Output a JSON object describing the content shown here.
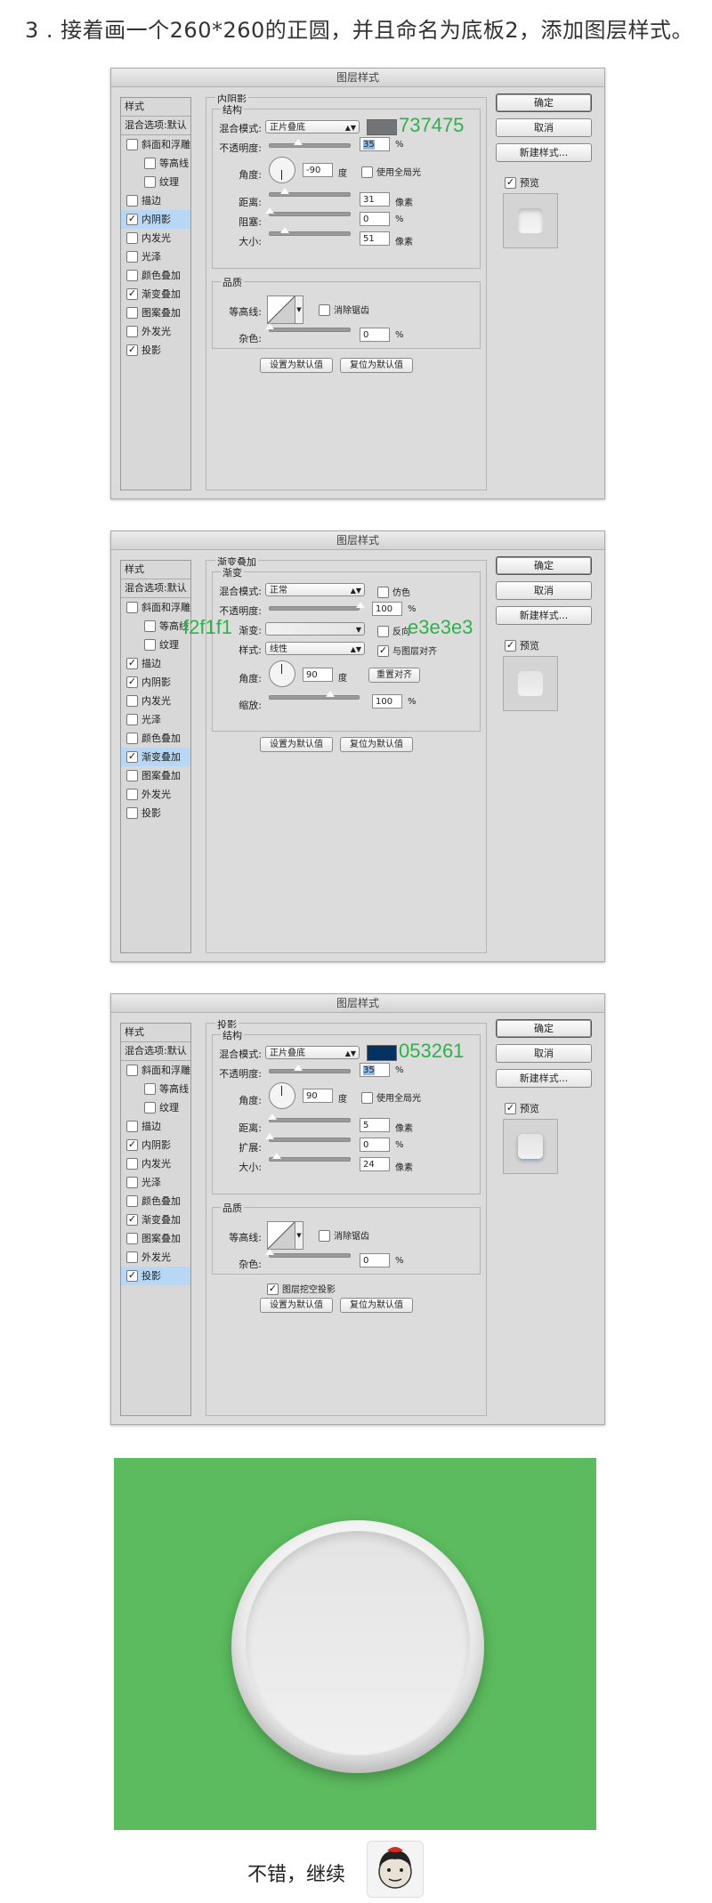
{
  "heading": "3 . 接着画一个260*260的正圆，并且命名为底板2，添加图层样式。",
  "dialogs": [
    {
      "title": "图层样式",
      "styles_header": "样式",
      "blend_default": "混合选项:默认",
      "items": [
        {
          "label": "斜面和浮雕",
          "checked": false,
          "sub": false,
          "active": false
        },
        {
          "label": "等高线",
          "checked": false,
          "sub": true,
          "active": false
        },
        {
          "label": "纹理",
          "checked": false,
          "sub": true,
          "active": false
        },
        {
          "label": "描边",
          "checked": false,
          "sub": false,
          "active": false
        },
        {
          "label": "内阴影",
          "checked": true,
          "sub": false,
          "active": true
        },
        {
          "label": "内发光",
          "checked": false,
          "sub": false,
          "active": false
        },
        {
          "label": "光泽",
          "checked": false,
          "sub": false,
          "active": false
        },
        {
          "label": "颜色叠加",
          "checked": false,
          "sub": false,
          "active": false
        },
        {
          "label": "渐变叠加",
          "checked": true,
          "sub": false,
          "active": false
        },
        {
          "label": "图案叠加",
          "checked": false,
          "sub": false,
          "active": false
        },
        {
          "label": "外发光",
          "checked": false,
          "sub": false,
          "active": false
        },
        {
          "label": "投影",
          "checked": true,
          "sub": false,
          "active": false
        }
      ],
      "section_title": "内阴影",
      "structure_label": "结构",
      "blend_mode_label": "混合模式:",
      "blend_mode": "正片叠底",
      "swatch_color": "#737475",
      "swatch_note": "737475",
      "opacity_label": "不透明度:",
      "opacity": "35",
      "opacity_level": 0.35,
      "angle_label": "角度:",
      "angle": "-90",
      "angle_unit": "度",
      "global_light": "使用全局光",
      "distance_label": "距离:",
      "distance": "31",
      "distance_level": 0.18,
      "choke_label": "阻塞:",
      "choke": "0",
      "choke_level": 0.0,
      "size_label": "大小:",
      "size": "51",
      "size_level": 0.19,
      "px": "像素",
      "percent": "%",
      "quality_label": "品质",
      "contour_label": "等高线:",
      "antialias": "消除锯齿",
      "noise_label": "杂色:",
      "noise": "0",
      "btn_default": "设置为默认值",
      "btn_reset": "复位为默认值",
      "ok": "确定",
      "cancel": "取消",
      "new_style": "新建样式...",
      "preview": "预览"
    },
    {
      "title": "图层样式",
      "styles_header": "样式",
      "blend_default": "混合选项:默认",
      "items": [
        {
          "label": "斜面和浮雕",
          "checked": false,
          "sub": false,
          "active": false
        },
        {
          "label": "等高线",
          "checked": false,
          "sub": true,
          "active": false
        },
        {
          "label": "纹理",
          "checked": false,
          "sub": true,
          "active": false
        },
        {
          "label": "描边",
          "checked": true,
          "sub": false,
          "active": false
        },
        {
          "label": "内阴影",
          "checked": true,
          "sub": false,
          "active": false
        },
        {
          "label": "内发光",
          "checked": false,
          "sub": false,
          "active": false
        },
        {
          "label": "光泽",
          "checked": false,
          "sub": false,
          "active": false
        },
        {
          "label": "颜色叠加",
          "checked": false,
          "sub": false,
          "active": false
        },
        {
          "label": "渐变叠加",
          "checked": true,
          "sub": false,
          "active": true
        },
        {
          "label": "图案叠加",
          "checked": false,
          "sub": false,
          "active": false
        },
        {
          "label": "外发光",
          "checked": false,
          "sub": false,
          "active": false
        },
        {
          "label": "投影",
          "checked": false,
          "sub": false,
          "active": false
        }
      ],
      "section_title": "渐变叠加",
      "structure_label": "渐变",
      "blend_mode_label": "混合模式:",
      "blend_mode": "正常",
      "dither": "仿色",
      "opacity_label": "不透明度:",
      "opacity": "100",
      "opacity_level": 1.0,
      "gradient_label": "渐变:",
      "gradient_from": "#f2f1f1",
      "gradient_to": "#e3e3e3",
      "note_left": "f2f1f1",
      "note_right": "e3e3e3",
      "reverse": "反向",
      "style_label": "样式:",
      "style_value": "线性",
      "align_layer": "与图层对齐",
      "angle_label": "角度:",
      "angle": "90",
      "angle_unit": "度",
      "reset_align": "重置对齐",
      "scale_label": "缩放:",
      "scale": "100",
      "scale_level": 0.67,
      "percent": "%",
      "btn_default": "设置为默认值",
      "btn_reset": "复位为默认值",
      "ok": "确定",
      "cancel": "取消",
      "new_style": "新建样式...",
      "preview": "预览"
    },
    {
      "title": "图层样式",
      "styles_header": "样式",
      "blend_default": "混合选项:默认",
      "items": [
        {
          "label": "斜面和浮雕",
          "checked": false,
          "sub": false,
          "active": false
        },
        {
          "label": "等高线",
          "checked": false,
          "sub": true,
          "active": false
        },
        {
          "label": "纹理",
          "checked": false,
          "sub": true,
          "active": false
        },
        {
          "label": "描边",
          "checked": false,
          "sub": false,
          "active": false
        },
        {
          "label": "内阴影",
          "checked": true,
          "sub": false,
          "active": false
        },
        {
          "label": "内发光",
          "checked": false,
          "sub": false,
          "active": false
        },
        {
          "label": "光泽",
          "checked": false,
          "sub": false,
          "active": false
        },
        {
          "label": "颜色叠加",
          "checked": false,
          "sub": false,
          "active": false
        },
        {
          "label": "渐变叠加",
          "checked": true,
          "sub": false,
          "active": false
        },
        {
          "label": "图案叠加",
          "checked": false,
          "sub": false,
          "active": false
        },
        {
          "label": "外发光",
          "checked": false,
          "sub": false,
          "active": false
        },
        {
          "label": "投影",
          "checked": true,
          "sub": false,
          "active": true
        }
      ],
      "section_title": "投影",
      "structure_label": "结构",
      "blend_mode_label": "混合模式:",
      "blend_mode": "正片叠底",
      "swatch_color": "#053261",
      "swatch_note": "053261",
      "opacity_label": "不透明度:",
      "opacity": "35",
      "opacity_level": 0.35,
      "angle_label": "角度:",
      "angle": "90",
      "angle_unit": "度",
      "global_light": "使用全局光",
      "distance_label": "距离:",
      "distance": "5",
      "distance_level": 0.03,
      "spread_label": "扩展:",
      "spread": "0",
      "spread_level": 0.0,
      "size_label": "大小:",
      "size": "24",
      "size_level": 0.09,
      "px": "像素",
      "percent": "%",
      "quality_label": "品质",
      "contour_label": "等高线:",
      "antialias": "消除锯齿",
      "noise_label": "杂色:",
      "noise": "0",
      "knockout": "图层挖空投影",
      "btn_default": "设置为默认值",
      "btn_reset": "复位为默认值",
      "ok": "确定",
      "cancel": "取消",
      "new_style": "新建样式...",
      "preview": "预览"
    }
  ],
  "result": {
    "background": "#5cbb5e"
  },
  "caption": "不错，继续"
}
